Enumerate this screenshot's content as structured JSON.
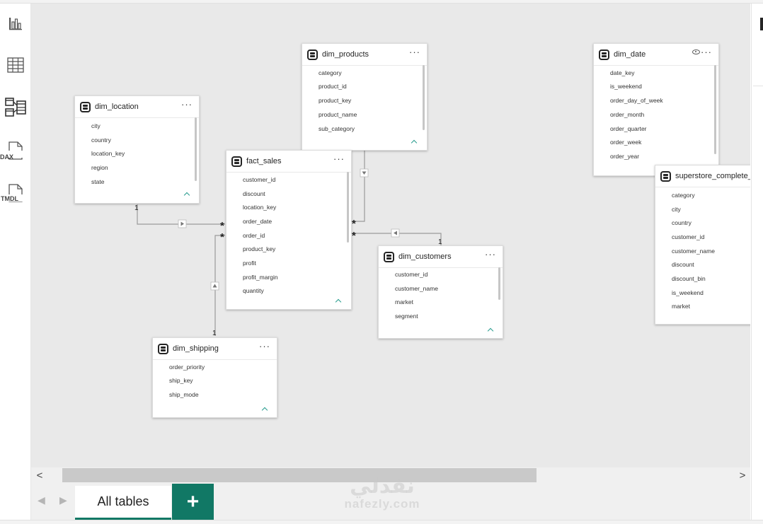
{
  "rail": {
    "report_view": "report-view-icon",
    "table_view": "table-view-icon",
    "model_view": "model-view-icon",
    "dax_label": "DAX",
    "tmdl_label": "TMDL"
  },
  "tables": {
    "dim_location": {
      "name": "dim_location",
      "fields": [
        "city",
        "country",
        "location_key",
        "region",
        "state"
      ]
    },
    "dim_products": {
      "name": "dim_products",
      "fields": [
        "category",
        "product_id",
        "product_key",
        "product_name",
        "sub_category"
      ]
    },
    "dim_date": {
      "name": "dim_date",
      "fields": [
        "date_key",
        "is_weekend",
        "order_day_of_week",
        "order_month",
        "order_quarter",
        "order_week",
        "order_year"
      ]
    },
    "fact_sales": {
      "name": "fact_sales",
      "fields": [
        "customer_id",
        "discount",
        "location_key",
        "order_date",
        "order_id",
        "product_key",
        "profit",
        "profit_margin",
        "quantity"
      ]
    },
    "dim_customers": {
      "name": "dim_customers",
      "fields": [
        "customer_id",
        "customer_name",
        "market",
        "segment"
      ]
    },
    "dim_shipping": {
      "name": "dim_shipping",
      "fields": [
        "order_priority",
        "ship_key",
        "ship_mode"
      ]
    },
    "superstore": {
      "name": "superstore_complete_a",
      "fields": [
        "category",
        "city",
        "country",
        "customer_id",
        "customer_name",
        "discount",
        "discount_bin",
        "is_weekend",
        "market"
      ]
    }
  },
  "more_glyph": "···",
  "cardinality": {
    "one": "1",
    "many": "*"
  },
  "tabs": {
    "all_tables": "All tables",
    "add": "+"
  },
  "watermark": {
    "arabic": "نفذلي",
    "latin": "nafezly.com"
  },
  "scroll": {
    "left": "<",
    "right": ">"
  },
  "accent_color": "#117865"
}
